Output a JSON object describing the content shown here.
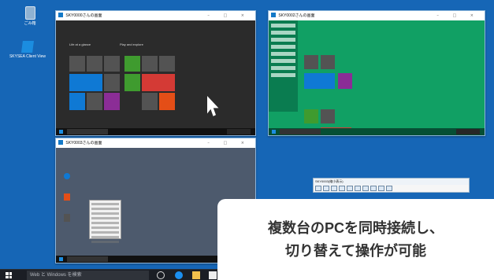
{
  "desktop_icons": [
    {
      "label": "ごみ箱",
      "icon": "recycle-bin-icon"
    },
    {
      "label": "SKYSEA Client View",
      "icon": "skysea-client-view-icon"
    }
  ],
  "windows": [
    {
      "title": "SKY0000さんの画面",
      "controls": "– □ ×"
    },
    {
      "title": "SKY0002さんの画面",
      "controls": "– □ ×"
    },
    {
      "title": "SKY0003さんの画面",
      "controls": "– □ ×"
    }
  ],
  "start_menu": {
    "left_group": "Life at a glance",
    "right_group": "Play and explore"
  },
  "floating_toolbar": {
    "title": "SKY0003(縮小表示)",
    "icons": [
      "display-icon",
      "arrow-icon",
      "pen-icon",
      "magnifier-icon",
      "transfer-icon",
      "settings-icon",
      "screen-icon",
      "zoom-icon",
      "refresh-icon",
      "close-icon"
    ]
  },
  "taskbar": {
    "search_text": "Web と Windows を検索",
    "icons": [
      "windows-logo-icon",
      "cortana-icon",
      "edge-icon",
      "folder-icon",
      "store-icon"
    ]
  },
  "callout": {
    "text": "複数台のPCを同時接続し、\n切り替えて操作が可能"
  },
  "colors": {
    "desktop": "#1666b6",
    "start_menu_dark": "#2b2b2b",
    "start_menu_green": "#11a064",
    "accent_blue": "#0f79d4",
    "accent_green": "#3f9b2f",
    "accent_red": "#d43a35"
  }
}
